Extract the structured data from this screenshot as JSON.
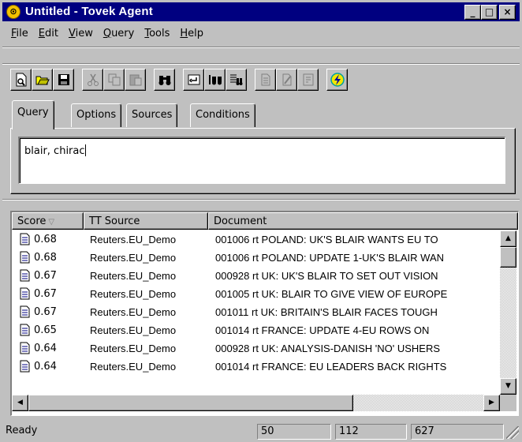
{
  "window": {
    "title": "Untitled - Tovek Agent",
    "app_icon_glyph": "⊙"
  },
  "caption_buttons": {
    "minimize": "_",
    "maximize": "□",
    "close": "×"
  },
  "menu": [
    {
      "label": "File",
      "accel": "F",
      "rest": "ile"
    },
    {
      "label": "Edit",
      "accel": "E",
      "rest": "dit"
    },
    {
      "label": "View",
      "accel": "V",
      "rest": "iew"
    },
    {
      "label": "Query",
      "accel": "Q",
      "rest": "uery"
    },
    {
      "label": "Tools",
      "accel": "T",
      "rest": "ools"
    },
    {
      "label": "Help",
      "accel": "H",
      "rest": "elp"
    }
  ],
  "toolbar": {
    "buttons": [
      {
        "name": "new-icon"
      },
      {
        "name": "open-folder-icon"
      },
      {
        "name": "save-disk-icon"
      },
      {
        "name": "cut-icon",
        "disabled": true
      },
      {
        "name": "copy-icon",
        "disabled": true
      },
      {
        "name": "paste-icon",
        "disabled": true
      },
      {
        "name": "binoculars-search-icon"
      },
      {
        "name": "enter-query-icon"
      },
      {
        "name": "search-hits-icon"
      },
      {
        "name": "search-results-icon"
      },
      {
        "name": "document-icon",
        "disabled": true
      },
      {
        "name": "edit-document-icon",
        "disabled": true
      },
      {
        "name": "properties-icon",
        "disabled": true
      },
      {
        "name": "lightning-execute-icon"
      }
    ]
  },
  "tabs": [
    {
      "label": "Query",
      "active": true
    },
    {
      "label": "Options"
    },
    {
      "label": "Sources"
    },
    {
      "label": "Conditions"
    }
  ],
  "query": {
    "text": "blair, chirac"
  },
  "results": {
    "columns": [
      "Score",
      "TT Source",
      "Document"
    ],
    "sorted_by": "Score",
    "rows": [
      {
        "score": "0.68",
        "source": "Reuters.EU_Demo",
        "document": "001006 rt POLAND: UK'S BLAIR WANTS EU TO"
      },
      {
        "score": "0.68",
        "source": "Reuters.EU_Demo",
        "document": "001006 rt POLAND: UPDATE 1-UK'S BLAIR WAN"
      },
      {
        "score": "0.67",
        "source": "Reuters.EU_Demo",
        "document": "000928 rt UK: UK'S BLAIR TO SET OUT VISION"
      },
      {
        "score": "0.67",
        "source": "Reuters.EU_Demo",
        "document": "001005 rt UK: BLAIR TO GIVE VIEW OF EUROPE"
      },
      {
        "score": "0.67",
        "source": "Reuters.EU_Demo",
        "document": "001011 rt UK: BRITAIN'S BLAIR FACES TOUGH"
      },
      {
        "score": "0.65",
        "source": "Reuters.EU_Demo",
        "document": "001014 rt FRANCE: UPDATE 4-EU ROWS ON"
      },
      {
        "score": "0.64",
        "source": "Reuters.EU_Demo",
        "document": "000928 rt UK: ANALYSIS-DANISH 'NO' USHERS"
      },
      {
        "score": "0.64",
        "source": "Reuters.EU_Demo",
        "document": "001014 rt FRANCE: EU LEADERS BACK RIGHTS"
      }
    ]
  },
  "status": {
    "text": "Ready",
    "panel1": "50",
    "panel2": "112",
    "panel3": "627"
  },
  "scroll_arrows": {
    "up": "▲",
    "down": "▼",
    "left": "◀",
    "right": "▶"
  },
  "sort_arrow": "▽",
  "colors": {
    "titlebar": "#000080",
    "face": "#c0c0c0",
    "accent_icon": "#f2c200"
  }
}
